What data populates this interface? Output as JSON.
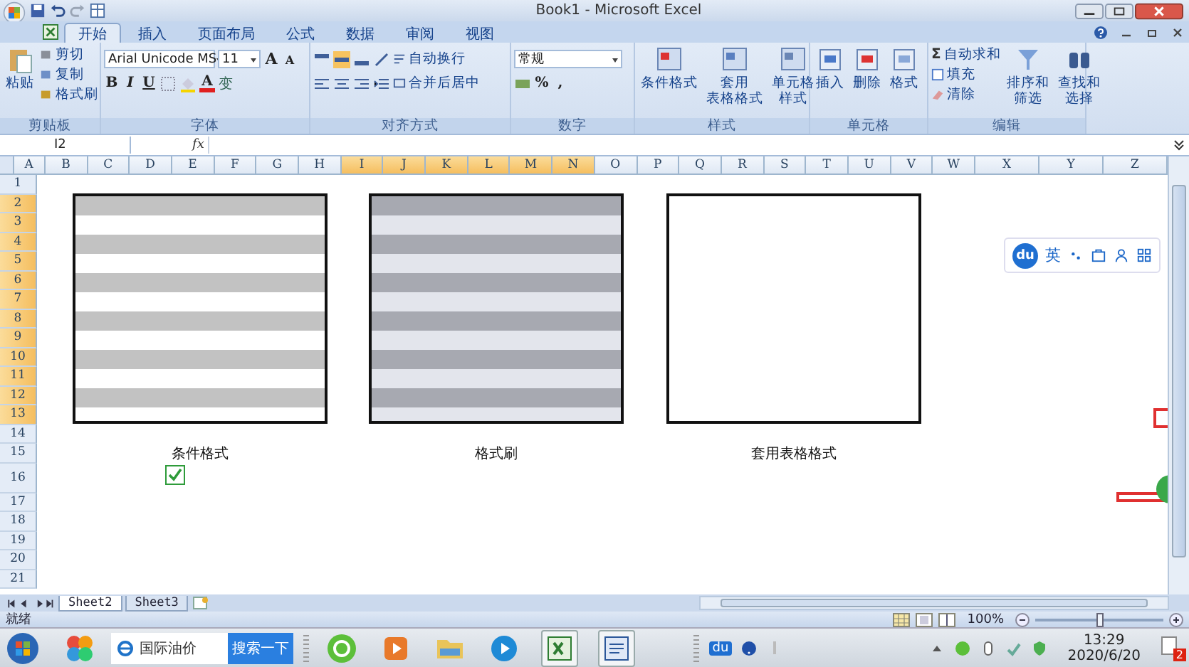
{
  "window": {
    "title": "Book1 - Microsoft Excel"
  },
  "tabs": [
    {
      "label": "开始",
      "selected": true
    },
    {
      "label": "插入",
      "selected": false
    },
    {
      "label": "页面布局",
      "selected": false
    },
    {
      "label": "公式",
      "selected": false
    },
    {
      "label": "数据",
      "selected": false
    },
    {
      "label": "审阅",
      "selected": false
    },
    {
      "label": "视图",
      "selected": false
    }
  ],
  "ribbon": {
    "clipboard": {
      "paste": "粘贴",
      "small": [
        "剪切",
        "复制",
        "格式刷"
      ],
      "label": "剪贴板"
    },
    "font": {
      "family": "Arial Unicode MS",
      "size": "11",
      "grow": "A",
      "shrink": "A",
      "styles": [
        "B",
        "I",
        "U"
      ],
      "color_letter": "A",
      "phonetic": "变",
      "label": "字体"
    },
    "align": {
      "wrap": "自动换行",
      "merge": "合并后居中",
      "label": "对齐方式"
    },
    "number": {
      "format": "常规",
      "percent": "%",
      "comma": ",",
      "label": "数字"
    },
    "styles": {
      "buttons": [
        {
          "lines": [
            "条件格式"
          ]
        },
        {
          "lines": [
            "套用",
            "表格格式"
          ]
        },
        {
          "lines": [
            "单元格",
            "样式"
          ]
        }
      ],
      "label": "样式"
    },
    "cells": {
      "buttons": [
        {
          "lines": [
            "插入"
          ]
        },
        {
          "lines": [
            "删除"
          ]
        },
        {
          "lines": [
            "格式"
          ]
        }
      ],
      "label": "单元格"
    },
    "editing": {
      "sum_glyph": "Σ",
      "small": [
        "自动求和",
        "填充",
        "清除"
      ],
      "buttons": [
        {
          "lines": [
            "排序和",
            "筛选"
          ]
        },
        {
          "lines": [
            "查找和",
            "选择"
          ]
        }
      ],
      "label": "编辑"
    }
  },
  "formula_bar": {
    "name_box": "I2",
    "fx": "fx"
  },
  "sheet": {
    "columns": [
      {
        "label": "A",
        "selected": false
      },
      {
        "label": "B",
        "selected": false
      },
      {
        "label": "C",
        "selected": false
      },
      {
        "label": "D",
        "selected": false
      },
      {
        "label": "E",
        "selected": false
      },
      {
        "label": "F",
        "selected": false
      },
      {
        "label": "G",
        "selected": false
      },
      {
        "label": "H",
        "selected": false
      },
      {
        "label": "I",
        "selected": true
      },
      {
        "label": "J",
        "selected": true
      },
      {
        "label": "K",
        "selected": true
      },
      {
        "label": "L",
        "selected": true
      },
      {
        "label": "M",
        "selected": true
      },
      {
        "label": "N",
        "selected": true
      },
      {
        "label": "O",
        "selected": false
      },
      {
        "label": "P",
        "selected": false
      },
      {
        "label": "Q",
        "selected": false
      },
      {
        "label": "R",
        "selected": false
      },
      {
        "label": "S",
        "selected": false
      },
      {
        "label": "T",
        "selected": false
      },
      {
        "label": "U",
        "selected": false
      },
      {
        "label": "V",
        "selected": false
      },
      {
        "label": "W",
        "selected": false
      },
      {
        "label": "X",
        "selected": false
      },
      {
        "label": "Y",
        "selected": false
      },
      {
        "label": "Z",
        "selected": false
      }
    ],
    "rows": [
      {
        "label": "1",
        "selected": false
      },
      {
        "label": "2",
        "selected": true
      },
      {
        "label": "3",
        "selected": true
      },
      {
        "label": "4",
        "selected": true
      },
      {
        "label": "5",
        "selected": true
      },
      {
        "label": "6",
        "selected": true
      },
      {
        "label": "7",
        "selected": true
      },
      {
        "label": "8",
        "selected": true
      },
      {
        "label": "9",
        "selected": true
      },
      {
        "label": "10",
        "selected": true
      },
      {
        "label": "11",
        "selected": true
      },
      {
        "label": "12",
        "selected": true
      },
      {
        "label": "13",
        "selected": true
      },
      {
        "label": "14",
        "selected": false
      },
      {
        "label": "15",
        "selected": false
      },
      {
        "label": "16",
        "selected": false
      },
      {
        "label": "17",
        "selected": false
      },
      {
        "label": "18",
        "selected": false
      },
      {
        "label": "19",
        "selected": false
      },
      {
        "label": "20",
        "selected": false
      },
      {
        "label": "21",
        "selected": false
      }
    ],
    "shapes": [
      {
        "kind": "light-stripes",
        "caption": "条件格式"
      },
      {
        "kind": "dark-stripes",
        "caption": "格式刷"
      },
      {
        "kind": "blank",
        "caption": "套用表格格式"
      }
    ],
    "checkbox": {
      "checked": true
    }
  },
  "ime_toolbar": {
    "logo": "du",
    "mode": "英"
  },
  "sheet_tabs": [
    {
      "label": "Sheet2",
      "selected": true
    },
    {
      "label": "Sheet3",
      "selected": false
    }
  ],
  "status_bar": {
    "text": "就绪",
    "zoom": "100%",
    "zoom_slider": {
      "level": 0.5
    }
  },
  "taskbar": {
    "search_value": "国际油价",
    "search_button": "搜索一下",
    "tray_logo": "du",
    "time": "13:29",
    "date": "2020/6/20",
    "badge": "2"
  }
}
